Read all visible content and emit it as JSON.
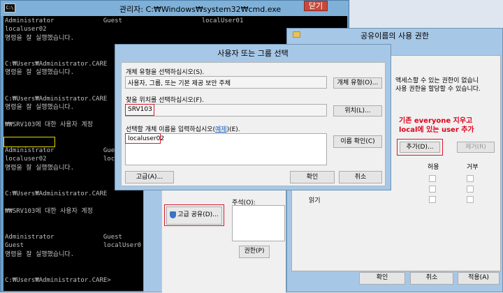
{
  "cmd": {
    "icon_label": "C:\\",
    "title": "관리자: C:₩Windows₩system32₩cmd.exe",
    "lines": [
      "Administrator             Guest                     localUser01",
      "localuser02",
      "명령을 잘 실행했습니다.",
      "",
      "",
      "C:₩Users₩Administrator.CARE",
      "명령을 잘 실행했습니다.",
      "",
      "",
      "C:₩Users₩Administrator.CARE",
      "명령을 잘 실행했습니다.",
      "",
      "₩₩SRV103에 대한 사용자 계정",
      "",
      "",
      "Administrator             Guest",
      "localuser02               local",
      "명령을 잘 실행했습니다.",
      "",
      "",
      "C:₩Users₩Administrator.CARE",
      "",
      "₩₩SRV103에 대한 사용자 계정",
      "",
      "",
      "Administrator             Guest",
      "Guest                     localUser0",
      "명령을 잘 실행했습니다.",
      "",
      "",
      "C:₩Users₩Administrator.CARE>"
    ]
  },
  "permission": {
    "title": "공유이름의 사용 권한",
    "close_label": "닫기",
    "desc_line1": "액세스할 수 있는 권한이 없습니",
    "desc_line2": "사용 권한을 할당할 수 있습니다.",
    "note_line1": "기존 everyone 지우고",
    "note_line2": "local에 있는 user 추가",
    "add_label": "추가(D)...",
    "remove_label": "제거(R)",
    "allow_header": "허용",
    "deny_header": "거부",
    "read_label": "읽기",
    "ok_label": "확인",
    "cancel_label": "취소",
    "apply_label": "적용(A)"
  },
  "properties": {
    "advanced_share_label": "고급 공유(D)...",
    "comment_label": "주석(O):",
    "permission_label": "권한(P)"
  },
  "select_dialog": {
    "title": "사용자 또는 그룹 선택",
    "object_type_label": "개체 유형을 선택하십시오(S).",
    "object_type_value": "사용자, 그룹, 또는 기본 제공 보안 주체",
    "object_type_button": "개체 유형(O)...",
    "location_label": "찾을 위치를 선택하십시오(F).",
    "location_value": "SRV103",
    "location_button": "위치(L)...",
    "names_label_before": "선택할 개체 이름을 입력하십시오(",
    "names_label_link": "예제",
    "names_label_after": ")(E).",
    "names_value": "localuser02",
    "check_names_button": "이름 확인(C)",
    "advanced_button": "고급(A)...",
    "ok_button": "확인",
    "cancel_button": "취소"
  }
}
